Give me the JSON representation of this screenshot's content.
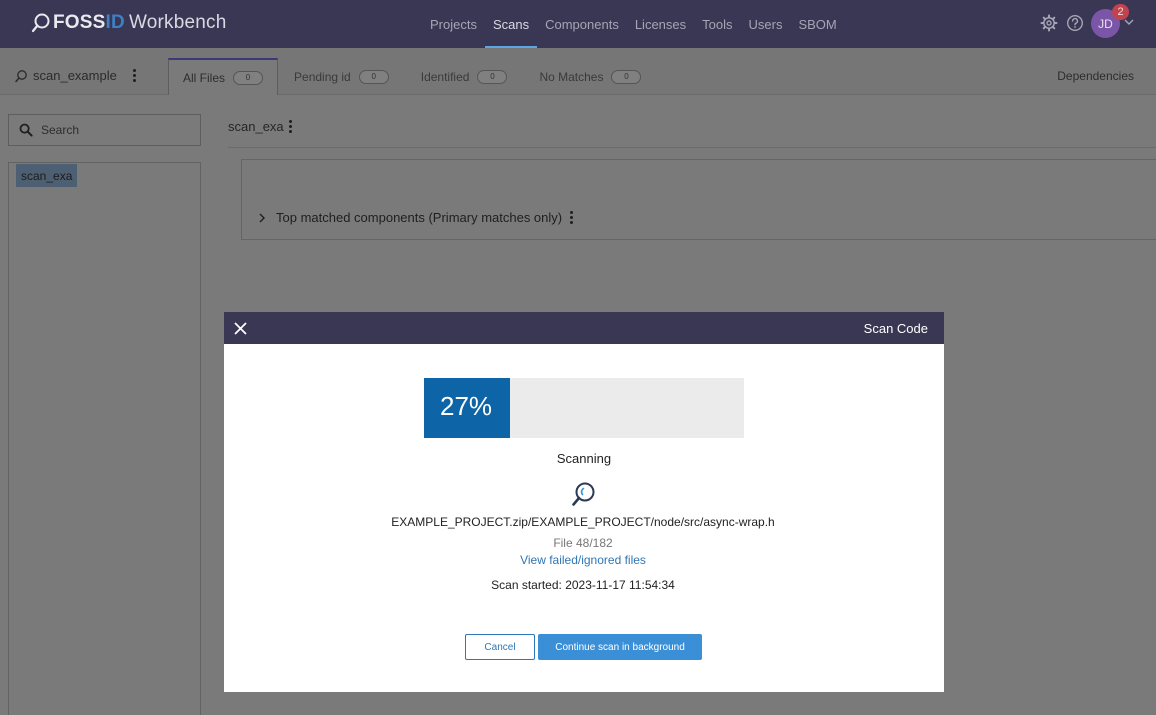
{
  "brand": {
    "foss": "FOSS",
    "id": "ID",
    "product": "Workbench"
  },
  "nav": {
    "items": [
      {
        "label": "Projects",
        "active": false
      },
      {
        "label": "Scans",
        "active": true
      },
      {
        "label": "Components",
        "active": false
      },
      {
        "label": "Licenses",
        "active": false
      },
      {
        "label": "Tools",
        "active": false
      },
      {
        "label": "Users",
        "active": false
      },
      {
        "label": "SBOM",
        "active": false
      }
    ],
    "user_initials": "JD",
    "notification_count": "2"
  },
  "scan": {
    "name": "scan_example",
    "tabs": [
      {
        "label": "All Files",
        "count": "0",
        "active": true
      },
      {
        "label": "Pending id",
        "count": "0",
        "active": false
      },
      {
        "label": "Identified",
        "count": "0",
        "active": false
      },
      {
        "label": "No Matches",
        "count": "0",
        "active": false
      }
    ],
    "dependencies_label": "Dependencies"
  },
  "sidebar": {
    "search_placeholder": "Search",
    "tree_root": "scan_exa"
  },
  "main": {
    "title": "scan_exa",
    "top_matched_label": "Top matched components (Primary matches only)"
  },
  "modal": {
    "title": "Scan Code",
    "progress_percent": 27,
    "progress_label": "27%",
    "status": "Scanning",
    "current_file": "EXAMPLE_PROJECT.zip/EXAMPLE_PROJECT/node/src/async-wrap.h",
    "file_count": "File 48/182",
    "failed_link": "View failed/ignored files",
    "started": "Scan started: 2023-11-17 11:54:34",
    "cancel_label": "Cancel",
    "background_label": "Continue scan in background"
  },
  "colors": {
    "topbar": "#3a3754",
    "accent": "#3b8fd6",
    "progress_fill": "#0d64a6",
    "link": "#2f76b5"
  }
}
